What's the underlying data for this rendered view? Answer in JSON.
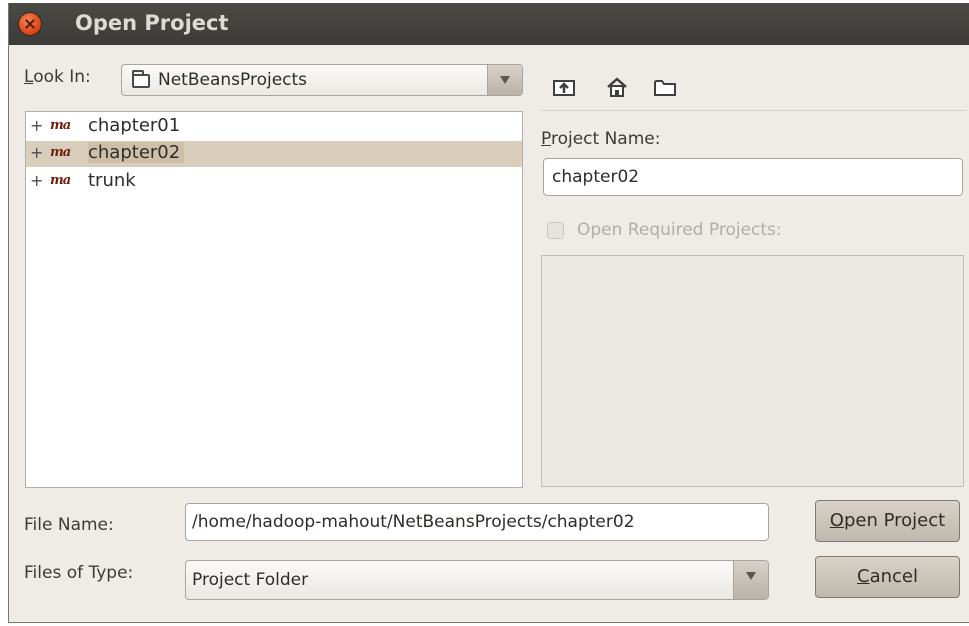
{
  "dialog": {
    "title": "Open Project"
  },
  "look_in": {
    "label": "Look In:",
    "value": "NetBeansProjects",
    "icon": "folder-icon"
  },
  "toolbar": {
    "icons": [
      "up-one-level-icon",
      "home-icon",
      "new-folder-icon"
    ]
  },
  "tree": {
    "items": [
      {
        "expander": "+",
        "icon": "maven-icon",
        "icon_text": "ma",
        "label": "chapter01",
        "selected": false
      },
      {
        "expander": "+",
        "icon": "maven-icon",
        "icon_text": "ma",
        "label": "chapter02",
        "selected": true
      },
      {
        "expander": "+",
        "icon": "maven-icon",
        "icon_text": "ma",
        "label": "trunk",
        "selected": false
      }
    ]
  },
  "project": {
    "name_label": "Project Name:",
    "name_value": "chapter02",
    "open_required_label": "Open Required Projects:",
    "open_required_checked": false
  },
  "file_name": {
    "label": "File Name:",
    "value": "/home/hadoop-mahout/NetBeansProjects/chapter02"
  },
  "file_type": {
    "label": "Files of Type:",
    "value": "Project Folder"
  },
  "buttons": {
    "open": "Open Project",
    "cancel": "Cancel"
  },
  "colors": {
    "titlebar": "#3c3b37",
    "window_bg": "#efebe7",
    "selection": "#d9cdbc",
    "close_button": "#df4a16"
  }
}
